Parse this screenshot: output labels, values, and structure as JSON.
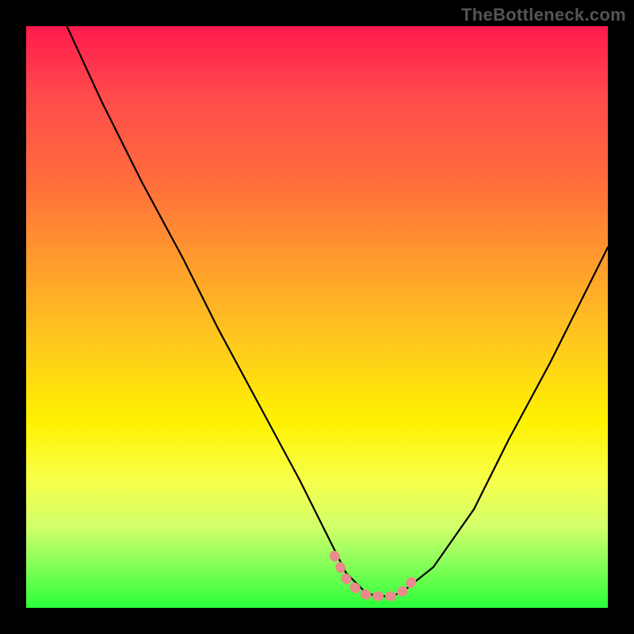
{
  "watermark": "TheBottleneck.com",
  "chart_data": {
    "type": "line",
    "title": "",
    "xlabel": "",
    "ylabel": "",
    "xlim": [
      0,
      100
    ],
    "ylim": [
      0,
      100
    ],
    "grid": false,
    "legend": false,
    "series": [
      {
        "name": "main-curve",
        "color": "#000000",
        "x": [
          7,
          13,
          20,
          27,
          33,
          40,
          47,
          53,
          55,
          58,
          60,
          63,
          65,
          70,
          77,
          83,
          90,
          97,
          100
        ],
        "y": [
          100,
          87,
          73,
          60,
          48,
          35,
          22,
          10,
          6,
          3,
          2,
          2,
          3,
          7,
          17,
          29,
          42,
          56,
          62
        ]
      },
      {
        "name": "base-marker",
        "color": "#e88b8b",
        "x": [
          53,
          55,
          57,
          59,
          61,
          63,
          65,
          66,
          67
        ],
        "y": [
          9,
          5,
          3,
          2,
          2,
          2,
          3,
          4,
          6
        ]
      }
    ],
    "background_gradient": {
      "stops": [
        {
          "pos": 0.0,
          "color": "#ff1a4d"
        },
        {
          "pos": 0.12,
          "color": "#ff4b4b"
        },
        {
          "pos": 0.26,
          "color": "#ff6b3d"
        },
        {
          "pos": 0.4,
          "color": "#ff9a2e"
        },
        {
          "pos": 0.54,
          "color": "#ffc81f"
        },
        {
          "pos": 0.68,
          "color": "#fff200"
        },
        {
          "pos": 0.78,
          "color": "#f7ff4a"
        },
        {
          "pos": 0.86,
          "color": "#d2ff6a"
        },
        {
          "pos": 0.92,
          "color": "#8cff5a"
        },
        {
          "pos": 1.0,
          "color": "#2bff3a"
        }
      ]
    }
  }
}
